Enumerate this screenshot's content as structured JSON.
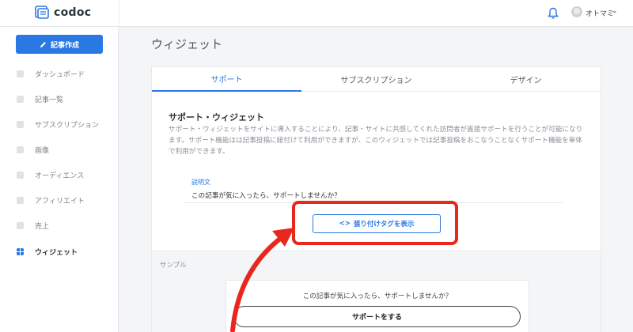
{
  "header": {
    "logo_text": "codoc",
    "username": "オトマミ",
    "caret": "⌄"
  },
  "sidebar": {
    "new_post_label": "記事作成",
    "items": [
      {
        "label": "ダッシュボード",
        "icon": "grid-icon"
      },
      {
        "label": "記事一覧",
        "icon": "list-icon"
      },
      {
        "label": "サブスクリプション",
        "icon": "lock-icon"
      },
      {
        "label": "画像",
        "icon": "image-icon"
      },
      {
        "label": "オーディエンス",
        "icon": "audience-icon"
      },
      {
        "label": "アフィリエイト",
        "icon": "share-icon"
      },
      {
        "label": "売上",
        "icon": "sales-icon"
      },
      {
        "label": "ウィジェット",
        "icon": "widget-icon",
        "active": true
      }
    ]
  },
  "main": {
    "page_title": "ウィジェット",
    "tabs": [
      {
        "label": "サポート",
        "active": true
      },
      {
        "label": "サブスクリプション"
      },
      {
        "label": "デザイン"
      }
    ],
    "section_title": "サポート・ウィジェット",
    "description": "サポート・ウィジェットをサイトに導入することにより、記事・サイトに共感してくれた訪問者が直接サポートを行うことが可能になります。サポート機能はは記事投稿に紐付けて利用ができますが、このウィジェットでは記事投稿をおこなうことなくサポート機能を単体で利用ができます。",
    "field_label": "説明文",
    "field_value": "この記事が気に入ったら、サポートしませんか？",
    "embed_button_icon": "<>",
    "embed_button_label": "張り付けタグを表示",
    "sample_label": "サンプル",
    "sample_text": "この記事が気に入ったら、サポートしませんか？",
    "support_button_label": "サポートをする"
  },
  "colors": {
    "accent": "#2a78e4",
    "annotation": "#e8281e"
  }
}
